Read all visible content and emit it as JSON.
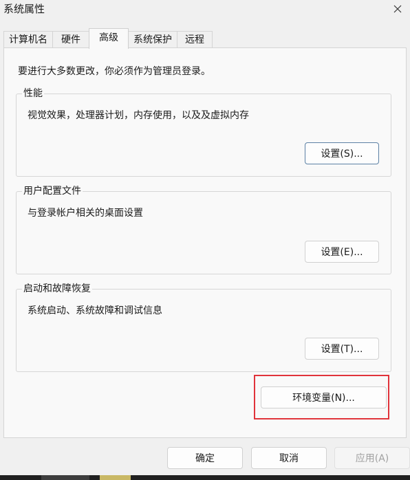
{
  "window": {
    "title": "系统属性",
    "close_icon": "close-icon"
  },
  "tabs": [
    {
      "label": "计算机名",
      "active": false
    },
    {
      "label": "硬件",
      "active": false
    },
    {
      "label": "高级",
      "active": true
    },
    {
      "label": "系统保护",
      "active": false
    },
    {
      "label": "远程",
      "active": false
    }
  ],
  "advanced": {
    "admin_note": "要进行大多数更改，你必须作为管理员登录。",
    "performance": {
      "title": "性能",
      "description": "视觉效果，处理器计划，内存使用，以及及虚拟内存",
      "settings_button": "设置(S)..."
    },
    "user_profiles": {
      "title": "用户配置文件",
      "description": "与登录帐户相关的桌面设置",
      "settings_button": "设置(E)..."
    },
    "startup_recovery": {
      "title": "启动和故障恢复",
      "description": "系统启动、系统故障和调试信息",
      "settings_button": "设置(T)..."
    },
    "env_vars_button": "环境变量(N)...",
    "highlight_color": "#e0333a"
  },
  "footer": {
    "ok_label": "确定",
    "cancel_label": "取消",
    "apply_label": "应用(A)"
  }
}
